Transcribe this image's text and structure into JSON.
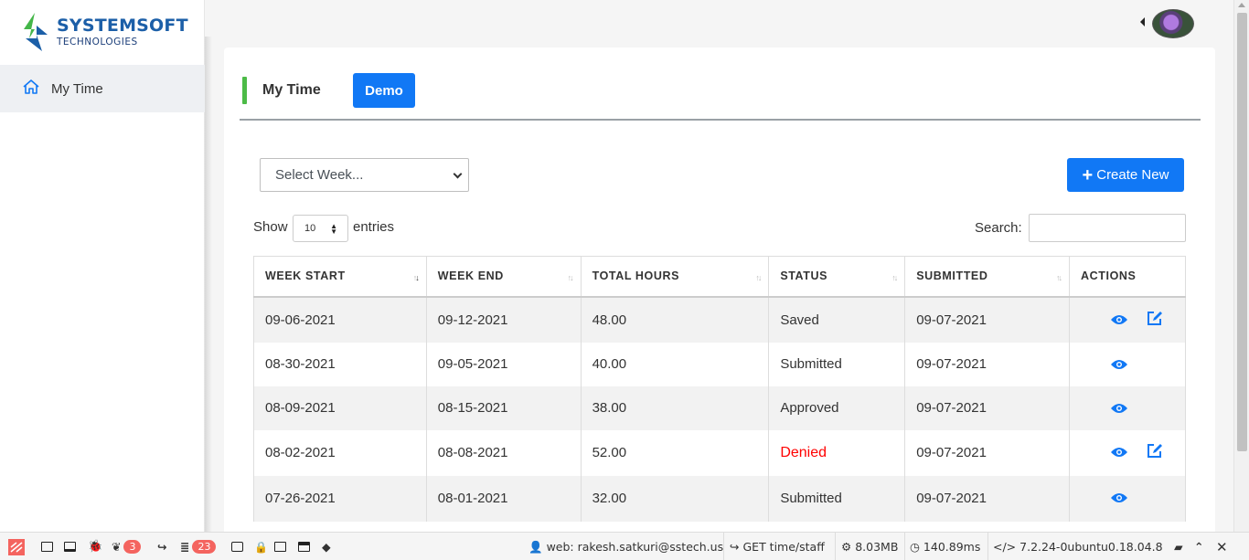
{
  "brand": {
    "name": "SYSTEMSOFT",
    "sub": "TECHNOLOGIES",
    "color": "#1c5fa8",
    "accent": "#44b649"
  },
  "sidebar": {
    "items": [
      {
        "label": "My Time",
        "icon": "home-icon"
      }
    ]
  },
  "tabs": [
    {
      "label": "My Time",
      "active": true
    },
    {
      "label": "Demo"
    }
  ],
  "toolbar": {
    "select_week_placeholder": "Select Week...",
    "create_label": "Create New"
  },
  "datatable": {
    "show_label": "Show",
    "page_length": "10",
    "entries_label": "entries",
    "search_label": "Search:",
    "search_value": "",
    "columns": [
      "WEEK START",
      "WEEK END",
      "TOTAL HOURS",
      "STATUS",
      "SUBMITTED",
      "ACTIONS"
    ],
    "rows": [
      {
        "week_start": "09-06-2021",
        "week_end": "09-12-2021",
        "total_hours": "48.00",
        "status": "Saved",
        "submitted": "09-07-2021",
        "actions": [
          "view",
          "edit"
        ]
      },
      {
        "week_start": "08-30-2021",
        "week_end": "09-05-2021",
        "total_hours": "40.00",
        "status": "Submitted",
        "submitted": "09-07-2021",
        "actions": [
          "view"
        ]
      },
      {
        "week_start": "08-09-2021",
        "week_end": "08-15-2021",
        "total_hours": "38.00",
        "status": "Approved",
        "submitted": "09-07-2021",
        "actions": [
          "view"
        ]
      },
      {
        "week_start": "08-02-2021",
        "week_end": "08-08-2021",
        "total_hours": "52.00",
        "status": "Denied",
        "submitted": "09-07-2021",
        "actions": [
          "view",
          "edit"
        ]
      },
      {
        "week_start": "07-26-2021",
        "week_end": "08-01-2021",
        "total_hours": "32.00",
        "status": "Submitted",
        "submitted": "09-07-2021",
        "actions": [
          "view"
        ]
      }
    ]
  },
  "colors": {
    "primary": "#1178f5",
    "denied": "#ff0000",
    "tab_accent": "#4cbb47"
  },
  "debugbar": {
    "badge_logs": "3",
    "badge_queries": "23",
    "user": "web: rakesh.satkuri@sstech.us",
    "route": "GET time/staff",
    "memory": "8.03MB",
    "time": "140.89ms",
    "php": "7.2.24-0ubuntu0.18.04.8"
  }
}
